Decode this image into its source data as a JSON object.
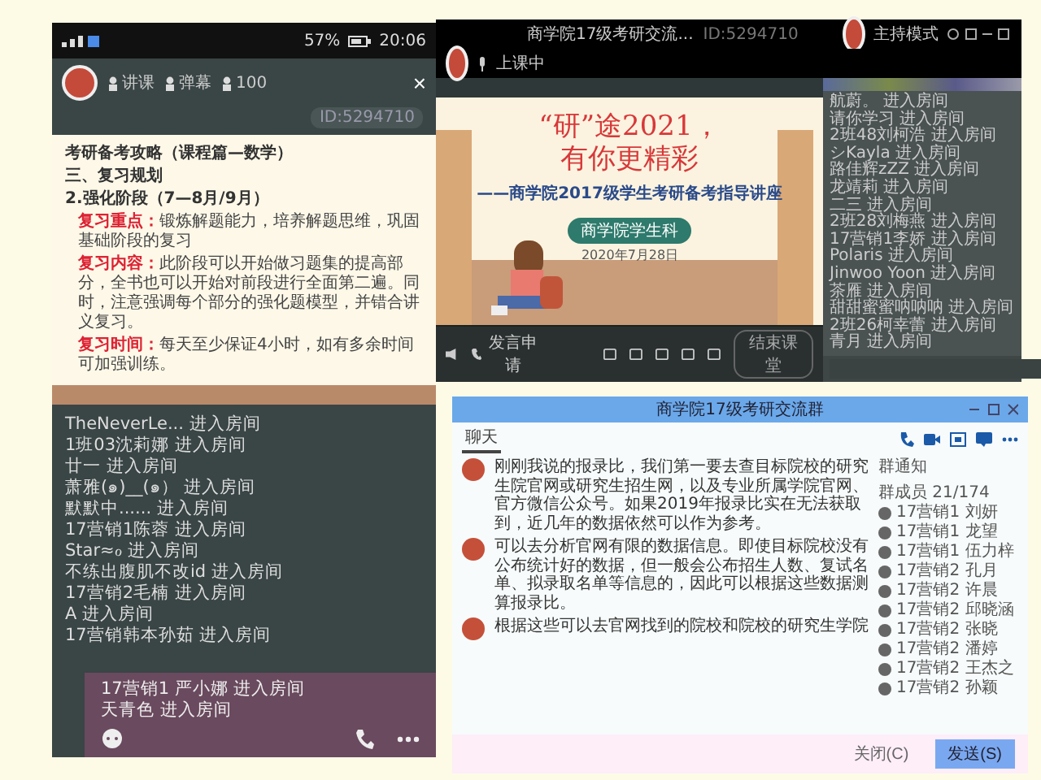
{
  "phone": {
    "status": {
      "battery": "57%",
      "time": "20:06"
    },
    "header": {
      "items": [
        "讲课",
        "弹幕",
        "100"
      ],
      "id": "ID:5294710",
      "close": "×"
    },
    "slide": {
      "title": "考研备考攻略（课程篇—数学）",
      "section": "三、复习规划",
      "stage": "2.强化阶段（7—8月/9月）",
      "points": [
        {
          "label": "复习重点：",
          "text": "锻炼解题能力，培养解题思维，巩固基础阶段的复习"
        },
        {
          "label": "复习内容：",
          "text": "此阶段可以开始做习题集的提高部分，全书也可以开始对前段进行全面第二遍。同时，注意强调每个部分的强化题模型，并错合讲义复习。"
        },
        {
          "label": "复习时间：",
          "text": "每天至少保证4小时，如有多余时间可加强训练。"
        }
      ]
    },
    "messages": [
      "TheNeverLe... 进入房间",
      "1班03沈莉娜 进入房间",
      "廿一 进入房间",
      "萧雅(๑)__(๑） 进入房间",
      "默默中...... 进入房间",
      "17营销1陈蓉 进入房间",
      "Star≈ℴ 进入房间",
      "不练出腹肌不改id 进入房间",
      "17营销2毛楠 进入房间",
      "A 进入房间",
      "17营销韩本孙茹 进入房间"
    ],
    "bottom_messages": [
      "17营销1 严小娜 进入房间",
      "天青色 进入房间"
    ]
  },
  "live": {
    "title": "商学院17级考研交流...",
    "id": "ID:5294710",
    "mode": "主持模式",
    "status": "上课中",
    "slide": {
      "quote": "“研”途2021，",
      "line2": "有你更精彩",
      "subtitle": "——商学院2017级学生考研备考指导讲座",
      "org": "商学院学生科",
      "date": "2020年7月28日"
    },
    "chat": [
      "航蔚。 进入房间",
      "请你学习 进入房间",
      "2班48刘柯浩 进入房间",
      "シKayla 进入房间",
      "路佳辉zZZ 进入房间",
      "龙靖莉 进入房间",
      "二三 进入房间",
      "2班28刘梅燕 进入房间",
      "17营销1李娇 进入房间",
      "Polaris 进入房间",
      "Jinwoo Yoon 进入房间",
      "茶雁 进入房间",
      "甜甜蜜蜜呐呐呐 进入房间",
      "2班26柯幸蕾 进入房间",
      "青月 进入房间"
    ],
    "apply": "发言申请",
    "end": "结束课堂"
  },
  "group": {
    "title": "商学院17级考研交流群",
    "tabs": [
      {
        "label": "聊天",
        "selected": true
      }
    ],
    "messages": [
      {
        "text": "刚刚我说的报录比，我们第一要去查目标院校的研究生院官网或研究生招生网，以及专业所属学院官网、官方微信公众号。如果2019年报录比实在无法获取到，近几年的数据依然可以作为参考。"
      },
      {
        "text": "可以去分析官网有限的数据信息。即使目标院校没有公布统计好的数据，但一般会公布招生人数、复试名单、拟录取名单等信息的，因此可以根据这些数据测算报录比。"
      },
      {
        "text": "根据这些可以去官网找到的院校和院校的研究生学院"
      }
    ],
    "notice": "群通知",
    "member_count": "群成员 21/174",
    "members": [
      "17营销1 刘妍",
      "17营销1 龙望",
      "17营销1 伍力梓",
      "17营销2 孔月",
      "17营销2 许晨",
      "17营销2 邱晓涵",
      "17营销2 张晓",
      "17营销2 潘婷",
      "17营销2 王杰之",
      "17营销2 孙颖"
    ],
    "close": "关闭(C)",
    "send": "发送(S)"
  }
}
